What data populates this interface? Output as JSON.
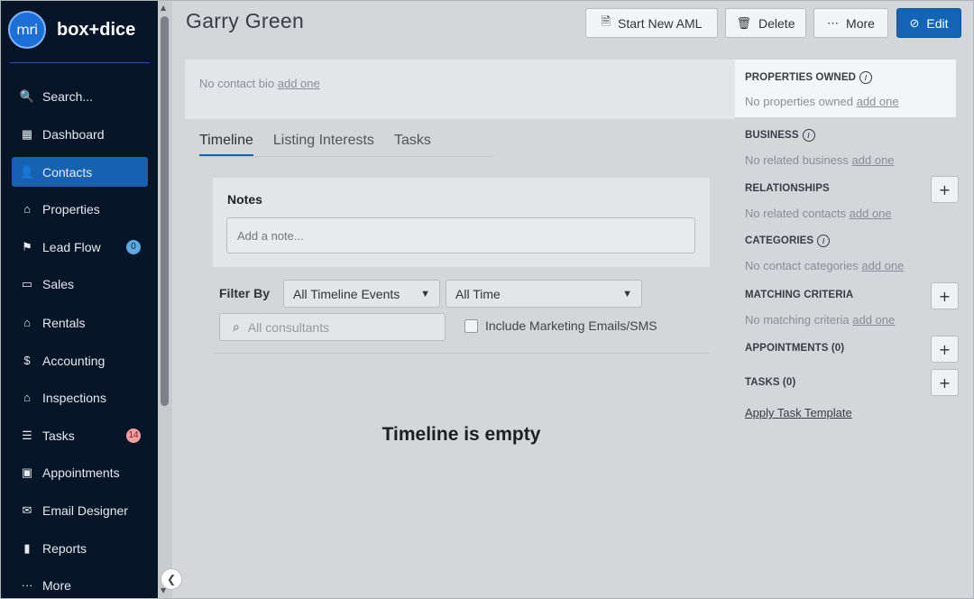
{
  "brand": {
    "logo_mark": "mri",
    "logo_text": "box+dice"
  },
  "sidebar": {
    "items": [
      {
        "label": "Search...",
        "icon": "search-icon",
        "glyph": "🔍"
      },
      {
        "label": "Dashboard",
        "icon": "dashboard-icon",
        "glyph": "▦"
      },
      {
        "label": "Contacts",
        "icon": "user-icon",
        "glyph": "👤",
        "active": true
      },
      {
        "label": "Properties",
        "icon": "home-icon",
        "glyph": "⌂"
      },
      {
        "label": "Lead Flow",
        "icon": "lead-flow-icon",
        "glyph": "⚑",
        "badge": "0"
      },
      {
        "label": "Sales",
        "icon": "sign-icon",
        "glyph": "▭"
      },
      {
        "label": "Rentals",
        "icon": "house-icon",
        "glyph": "⌂"
      },
      {
        "label": "Accounting",
        "icon": "dollar-icon",
        "glyph": "$"
      },
      {
        "label": "Inspections",
        "icon": "inspection-icon",
        "glyph": "⌂"
      },
      {
        "label": "Tasks",
        "icon": "tasks-icon",
        "glyph": "☰",
        "badge": "14"
      },
      {
        "label": "Appointments",
        "icon": "calendar-icon",
        "glyph": "▣"
      },
      {
        "label": "Email Designer",
        "icon": "envelope-icon",
        "glyph": "✉"
      },
      {
        "label": "Reports",
        "icon": "bar-chart-icon",
        "glyph": "▮"
      },
      {
        "label": "More",
        "icon": "more-dots-icon",
        "glyph": "···"
      }
    ]
  },
  "header": {
    "title": "Garry Green",
    "buttons": {
      "start_aml": "Start New AML",
      "delete": "Delete",
      "more": "More",
      "edit": "Edit"
    }
  },
  "bio": {
    "text": "No contact bio",
    "link": "add one"
  },
  "tabs": [
    "Timeline",
    "Listing Interests",
    "Tasks"
  ],
  "notes": {
    "title": "Notes",
    "placeholder": "Add a note..."
  },
  "filters": {
    "label": "Filter By",
    "events": "All Timeline Events",
    "time": "All Time",
    "consultants_placeholder": "All consultants",
    "include_marketing": "Include Marketing Emails/SMS"
  },
  "timeline_empty": "Timeline is empty",
  "right_panel": {
    "properties_owned": {
      "title": "PROPERTIES OWNED",
      "text": "No properties owned",
      "link": "add one"
    },
    "business": {
      "title": "BUSINESS",
      "text": "No related business",
      "link": "add one"
    },
    "relationships": {
      "title": "RELATIONSHIPS",
      "text": "No related contacts",
      "link": "add one"
    },
    "categories": {
      "title": "CATEGORIES",
      "text": "No contact categories",
      "link": "add one"
    },
    "matching": {
      "title": "MATCHING CRITERIA",
      "text": "No matching criteria",
      "link": "add one"
    },
    "appointments": {
      "title": "APPOINTMENTS (0)"
    },
    "tasks": {
      "title": "TASKS (0)"
    },
    "task_template": "Apply Task Template"
  }
}
